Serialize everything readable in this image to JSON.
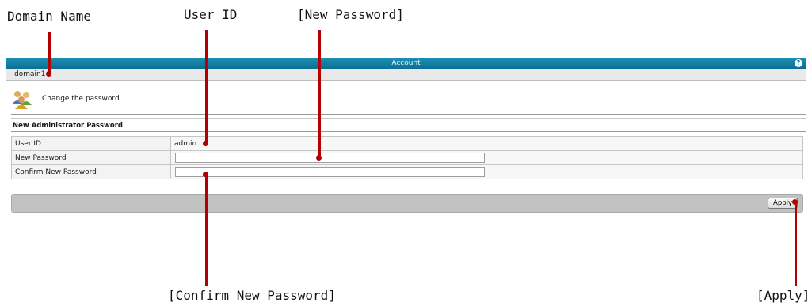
{
  "callouts": {
    "domain_name": "Domain Name",
    "user_id": "User ID",
    "new_password": "[New Password]",
    "confirm_new_password": "[Confirm New Password]",
    "apply": "[Apply]"
  },
  "window": {
    "title": "Account",
    "help_icon": "?"
  },
  "breadcrumb": {
    "domain": "domain1"
  },
  "page": {
    "heading": "Change the password",
    "icon": "users-icon"
  },
  "section": {
    "title": "New Administrator Password"
  },
  "form": {
    "rows": [
      {
        "label": "User ID",
        "value": "admin"
      },
      {
        "label": "New Password",
        "value": ""
      },
      {
        "label": "Confirm New Password",
        "value": ""
      }
    ]
  },
  "actions": {
    "apply_label": "Apply"
  },
  "colors": {
    "titlebar": "#0c6f95",
    "callout_line": "#b30000",
    "actionbar": "#c2c2c2"
  }
}
